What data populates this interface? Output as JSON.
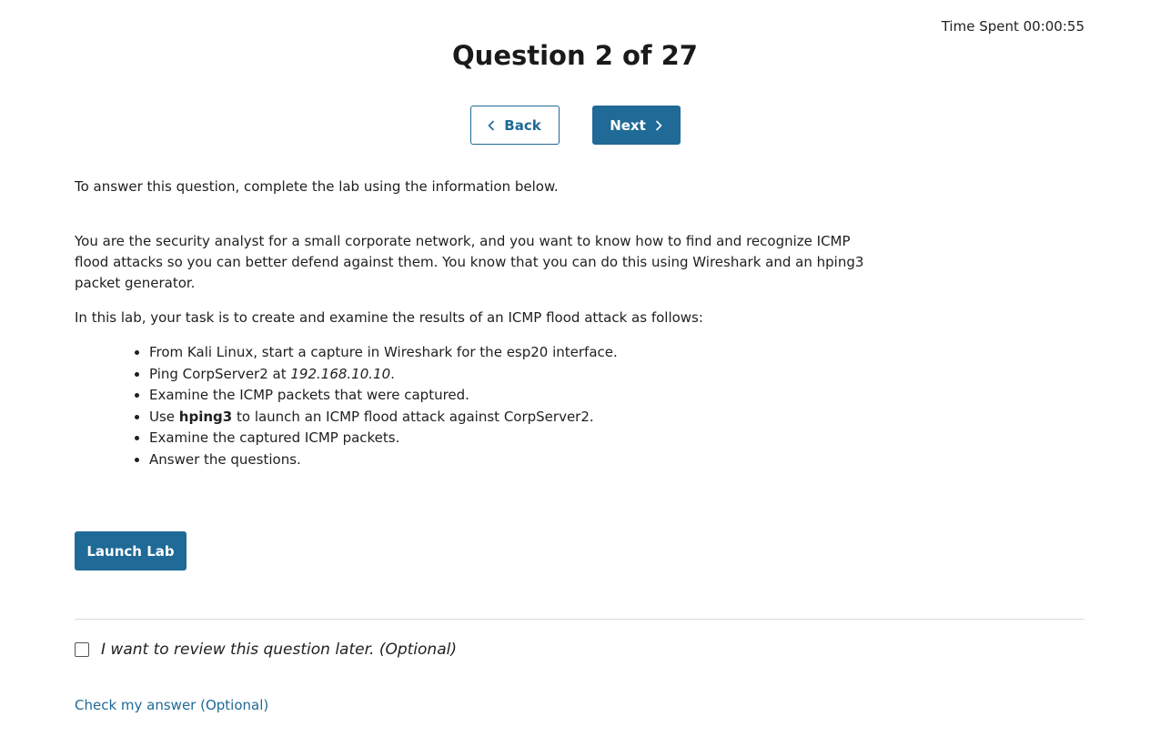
{
  "timer": {
    "label": "Time Spent 00:00:55"
  },
  "header": {
    "title": "Question 2 of 27"
  },
  "nav": {
    "back_label": "Back",
    "next_label": "Next"
  },
  "content": {
    "intro": "To answer this question, complete the lab using the information below.",
    "scenario": "You are the security analyst for a small corporate network, and you want to know how to find and recognize ICMP flood attacks so you can better defend against them. You know that you can do this using Wireshark and an hping3 packet generator.",
    "task": "In this lab, your task is to create and examine the results of an ICMP flood attack as follows:",
    "steps": [
      "From Kali Linux, start a capture in Wireshark for the esp20 interface.",
      {
        "before": "Ping CorpServer2 at ",
        "emphasis": "192.168.10.10",
        "after": "."
      },
      "Examine the ICMP packets that were captured.",
      {
        "before": "Use ",
        "strong": "hping3",
        "after": " to launch an ICMP flood attack against CorpServer2."
      },
      "Examine the captured ICMP packets.",
      "Answer the questions."
    ]
  },
  "actions": {
    "launch_label": "Launch Lab"
  },
  "review": {
    "label": "I want to review this question later. (Optional)",
    "checked": false
  },
  "footer": {
    "check_answer_label": "Check my answer (Optional)"
  },
  "colors": {
    "accent": "#1f6a96",
    "divider": "#d9d9d9"
  }
}
